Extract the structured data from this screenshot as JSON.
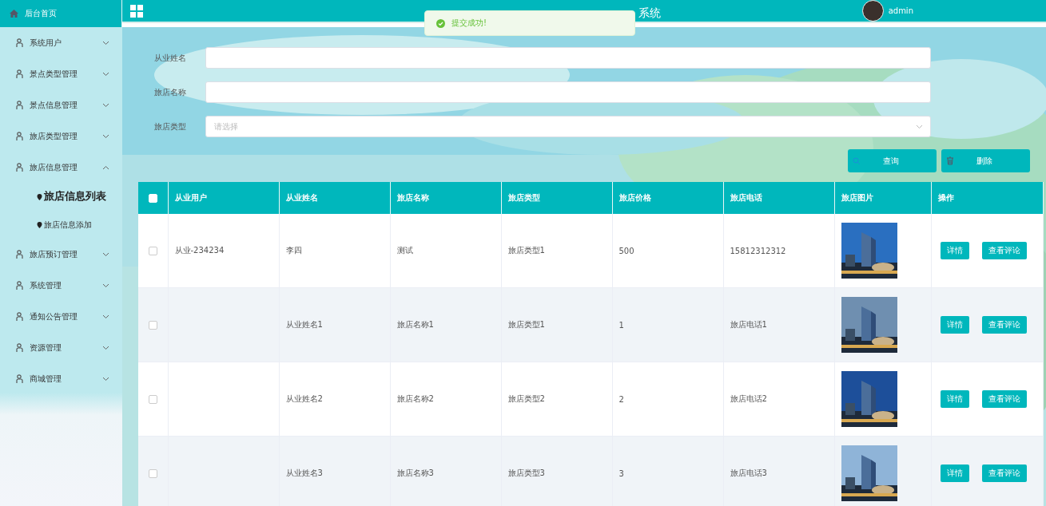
{
  "sidebar": {
    "home": "后台首页",
    "items": [
      {
        "label": "系统用户",
        "expanded": false
      },
      {
        "label": "景点类型管理",
        "expanded": false
      },
      {
        "label": "景点信息管理",
        "expanded": false
      },
      {
        "label": "旅店类型管理",
        "expanded": false
      },
      {
        "label": "旅店信息管理",
        "expanded": true,
        "children": [
          {
            "label": "旅店信息列表",
            "selected": true
          },
          {
            "label": "旅店信息添加",
            "selected": false
          }
        ]
      },
      {
        "label": "旅店预订管理",
        "expanded": false
      },
      {
        "label": "系统管理",
        "expanded": false
      },
      {
        "label": "通知公告管理",
        "expanded": false
      },
      {
        "label": "资源管理",
        "expanded": false
      },
      {
        "label": "商城管理",
        "expanded": false
      }
    ]
  },
  "header": {
    "title": "系统",
    "user": "admin"
  },
  "toast": {
    "message": "提交成功!"
  },
  "form": {
    "fields": [
      {
        "kind": "text",
        "label": "从业姓名"
      },
      {
        "kind": "text",
        "label": "旅店名称"
      },
      {
        "kind": "select",
        "label": "旅店类型",
        "placeholder": "请选择"
      }
    ],
    "buttons": [
      {
        "kind": "search",
        "label": "查询"
      },
      {
        "kind": "delete",
        "label": "删除"
      }
    ]
  },
  "table": {
    "all_checked": false,
    "columns": [
      "从业用户",
      "从业姓名",
      "旅店名称",
      "旅店类型",
      "旅店价格",
      "旅店电话",
      "旅店图片",
      "操作"
    ],
    "rows": [
      {
        "checked": false,
        "cells": [
          "从业-234234",
          "李四",
          "测试",
          "旅店类型1",
          "500",
          "15812312312"
        ],
        "actions": [
          "详情",
          "查看评论"
        ]
      },
      {
        "checked": false,
        "cells": [
          "",
          "从业姓名1",
          "旅店名称1",
          "旅店类型1",
          "1",
          "旅店电话1"
        ],
        "actions": [
          "详情",
          "查看评论"
        ]
      },
      {
        "checked": false,
        "cells": [
          "",
          "从业姓名2",
          "旅店名称2",
          "旅店类型2",
          "2",
          "旅店电话2"
        ],
        "actions": [
          "详情",
          "查看评论"
        ]
      },
      {
        "checked": false,
        "cells": [
          "",
          "从业姓名3",
          "旅店名称3",
          "旅店类型3",
          "3",
          "旅店电话3"
        ],
        "actions": [
          "详情",
          "查看评论"
        ]
      }
    ]
  }
}
